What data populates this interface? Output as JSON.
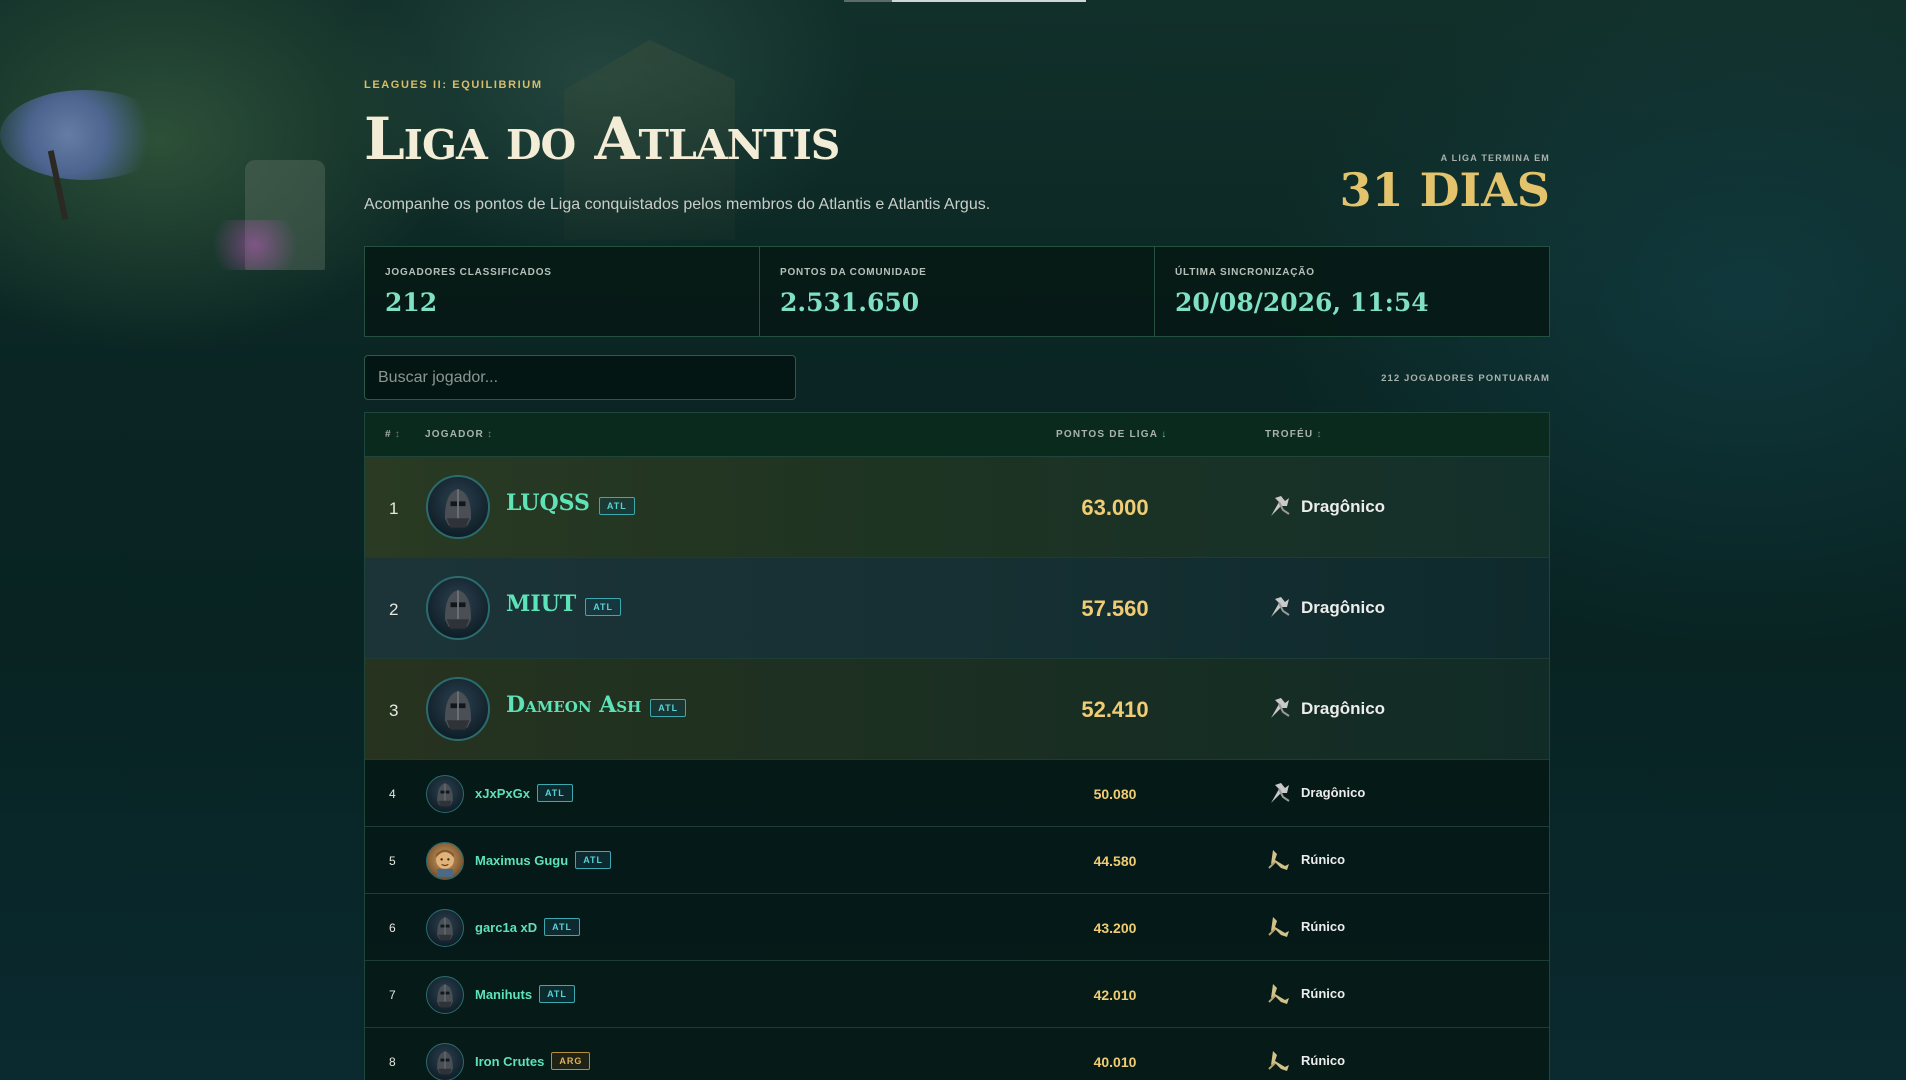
{
  "header": {
    "eyebrow": "LEAGUES II: EQUILIBRIUM",
    "title": "Liga do Atlantis",
    "subtitle": "Acompanhe os pontos de Liga conquistados pelos membros do Atlantis e Atlantis Argus.",
    "ends_label": "A LIGA TERMINA EM",
    "ends_value": "31 DIAS"
  },
  "stats": [
    {
      "label": "JOGADORES CLASSIFICADOS",
      "value": "212"
    },
    {
      "label": "PONTOS DA COMUNIDADE",
      "value": "2.531.650"
    },
    {
      "label": "ÚLTIMA SINCRONIZAÇÃO",
      "value": "20/08/2026, 11:54"
    }
  ],
  "search": {
    "placeholder": "Buscar jogador...",
    "value": ""
  },
  "count_label": "212 JOGADORES PONTUARAM",
  "table": {
    "headers": {
      "rank": "#",
      "player": "JOGADOR",
      "points": "PONTOS DE LIGA",
      "trophy": "TROFÉU"
    },
    "sort_icons": {
      "inactive": "↕",
      "active": "↓"
    },
    "rows": [
      {
        "rank": "1",
        "name": "LUQSS",
        "tag": "ATL",
        "points": "63.000",
        "trophy": "Dragônico",
        "avatar": "helmet-icon",
        "trophy_icon": "dragon-trophy-icon"
      },
      {
        "rank": "2",
        "name": "MIUT",
        "tag": "ATL",
        "points": "57.560",
        "trophy": "Dragônico",
        "avatar": "helmet-icon",
        "trophy_icon": "dragon-trophy-icon"
      },
      {
        "rank": "3",
        "name": "Dameon Ash",
        "tag": "ATL",
        "points": "52.410",
        "trophy": "Dragônico",
        "avatar": "helmet-icon",
        "trophy_icon": "dragon-trophy-icon"
      },
      {
        "rank": "4",
        "name": "xJxPxGx",
        "tag": "ATL",
        "points": "50.080",
        "trophy": "Dragônico",
        "avatar": "helmet-icon",
        "trophy_icon": "dragon-trophy-icon"
      },
      {
        "rank": "5",
        "name": "Maximus Gugu",
        "tag": "ATL",
        "points": "44.580",
        "trophy": "Rúnico",
        "avatar": "face-avatar",
        "trophy_icon": "rune-trophy-icon"
      },
      {
        "rank": "6",
        "name": "garc1a xD",
        "tag": "ATL",
        "points": "43.200",
        "trophy": "Rúnico",
        "avatar": "helmet-icon",
        "trophy_icon": "rune-trophy-icon"
      },
      {
        "rank": "7",
        "name": "Manihuts",
        "tag": "ATL",
        "points": "42.010",
        "trophy": "Rúnico",
        "avatar": "helmet-icon",
        "trophy_icon": "rune-trophy-icon"
      },
      {
        "rank": "8",
        "name": "Iron Crutes",
        "tag": "ARG",
        "points": "40.010",
        "trophy": "Rúnico",
        "avatar": "helmet-icon",
        "trophy_icon": "rune-trophy-icon"
      }
    ]
  },
  "colors": {
    "accent": "#5ee3b8",
    "gold": "#f0cc72",
    "tag_atl": "#58d2d6",
    "tag_arg": "#e0b25a"
  }
}
